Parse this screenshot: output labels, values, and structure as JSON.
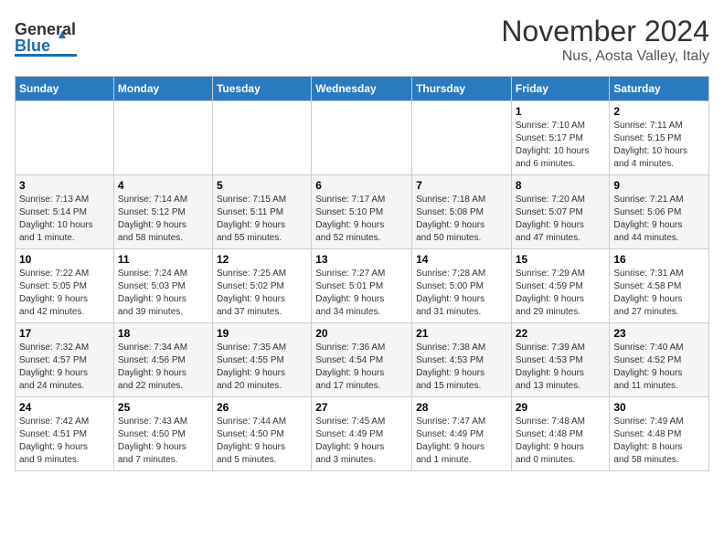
{
  "header": {
    "logo_general": "General",
    "logo_blue": "Blue",
    "title": "November 2024",
    "subtitle": "Nus, Aosta Valley, Italy"
  },
  "days_of_week": [
    "Sunday",
    "Monday",
    "Tuesday",
    "Wednesday",
    "Thursday",
    "Friday",
    "Saturday"
  ],
  "weeks": [
    {
      "days": [
        {
          "num": "",
          "info": ""
        },
        {
          "num": "",
          "info": ""
        },
        {
          "num": "",
          "info": ""
        },
        {
          "num": "",
          "info": ""
        },
        {
          "num": "",
          "info": ""
        },
        {
          "num": "1",
          "info": "Sunrise: 7:10 AM\nSunset: 5:17 PM\nDaylight: 10 hours\nand 6 minutes."
        },
        {
          "num": "2",
          "info": "Sunrise: 7:11 AM\nSunset: 5:15 PM\nDaylight: 10 hours\nand 4 minutes."
        }
      ]
    },
    {
      "days": [
        {
          "num": "3",
          "info": "Sunrise: 7:13 AM\nSunset: 5:14 PM\nDaylight: 10 hours\nand 1 minute."
        },
        {
          "num": "4",
          "info": "Sunrise: 7:14 AM\nSunset: 5:12 PM\nDaylight: 9 hours\nand 58 minutes."
        },
        {
          "num": "5",
          "info": "Sunrise: 7:15 AM\nSunset: 5:11 PM\nDaylight: 9 hours\nand 55 minutes."
        },
        {
          "num": "6",
          "info": "Sunrise: 7:17 AM\nSunset: 5:10 PM\nDaylight: 9 hours\nand 52 minutes."
        },
        {
          "num": "7",
          "info": "Sunrise: 7:18 AM\nSunset: 5:08 PM\nDaylight: 9 hours\nand 50 minutes."
        },
        {
          "num": "8",
          "info": "Sunrise: 7:20 AM\nSunset: 5:07 PM\nDaylight: 9 hours\nand 47 minutes."
        },
        {
          "num": "9",
          "info": "Sunrise: 7:21 AM\nSunset: 5:06 PM\nDaylight: 9 hours\nand 44 minutes."
        }
      ]
    },
    {
      "days": [
        {
          "num": "10",
          "info": "Sunrise: 7:22 AM\nSunset: 5:05 PM\nDaylight: 9 hours\nand 42 minutes."
        },
        {
          "num": "11",
          "info": "Sunrise: 7:24 AM\nSunset: 5:03 PM\nDaylight: 9 hours\nand 39 minutes."
        },
        {
          "num": "12",
          "info": "Sunrise: 7:25 AM\nSunset: 5:02 PM\nDaylight: 9 hours\nand 37 minutes."
        },
        {
          "num": "13",
          "info": "Sunrise: 7:27 AM\nSunset: 5:01 PM\nDaylight: 9 hours\nand 34 minutes."
        },
        {
          "num": "14",
          "info": "Sunrise: 7:28 AM\nSunset: 5:00 PM\nDaylight: 9 hours\nand 31 minutes."
        },
        {
          "num": "15",
          "info": "Sunrise: 7:29 AM\nSunset: 4:59 PM\nDaylight: 9 hours\nand 29 minutes."
        },
        {
          "num": "16",
          "info": "Sunrise: 7:31 AM\nSunset: 4:58 PM\nDaylight: 9 hours\nand 27 minutes."
        }
      ]
    },
    {
      "days": [
        {
          "num": "17",
          "info": "Sunrise: 7:32 AM\nSunset: 4:57 PM\nDaylight: 9 hours\nand 24 minutes."
        },
        {
          "num": "18",
          "info": "Sunrise: 7:34 AM\nSunset: 4:56 PM\nDaylight: 9 hours\nand 22 minutes."
        },
        {
          "num": "19",
          "info": "Sunrise: 7:35 AM\nSunset: 4:55 PM\nDaylight: 9 hours\nand 20 minutes."
        },
        {
          "num": "20",
          "info": "Sunrise: 7:36 AM\nSunset: 4:54 PM\nDaylight: 9 hours\nand 17 minutes."
        },
        {
          "num": "21",
          "info": "Sunrise: 7:38 AM\nSunset: 4:53 PM\nDaylight: 9 hours\nand 15 minutes."
        },
        {
          "num": "22",
          "info": "Sunrise: 7:39 AM\nSunset: 4:53 PM\nDaylight: 9 hours\nand 13 minutes."
        },
        {
          "num": "23",
          "info": "Sunrise: 7:40 AM\nSunset: 4:52 PM\nDaylight: 9 hours\nand 11 minutes."
        }
      ]
    },
    {
      "days": [
        {
          "num": "24",
          "info": "Sunrise: 7:42 AM\nSunset: 4:51 PM\nDaylight: 9 hours\nand 9 minutes."
        },
        {
          "num": "25",
          "info": "Sunrise: 7:43 AM\nSunset: 4:50 PM\nDaylight: 9 hours\nand 7 minutes."
        },
        {
          "num": "26",
          "info": "Sunrise: 7:44 AM\nSunset: 4:50 PM\nDaylight: 9 hours\nand 5 minutes."
        },
        {
          "num": "27",
          "info": "Sunrise: 7:45 AM\nSunset: 4:49 PM\nDaylight: 9 hours\nand 3 minutes."
        },
        {
          "num": "28",
          "info": "Sunrise: 7:47 AM\nSunset: 4:49 PM\nDaylight: 9 hours\nand 1 minute."
        },
        {
          "num": "29",
          "info": "Sunrise: 7:48 AM\nSunset: 4:48 PM\nDaylight: 9 hours\nand 0 minutes."
        },
        {
          "num": "30",
          "info": "Sunrise: 7:49 AM\nSunset: 4:48 PM\nDaylight: 8 hours\nand 58 minutes."
        }
      ]
    }
  ]
}
